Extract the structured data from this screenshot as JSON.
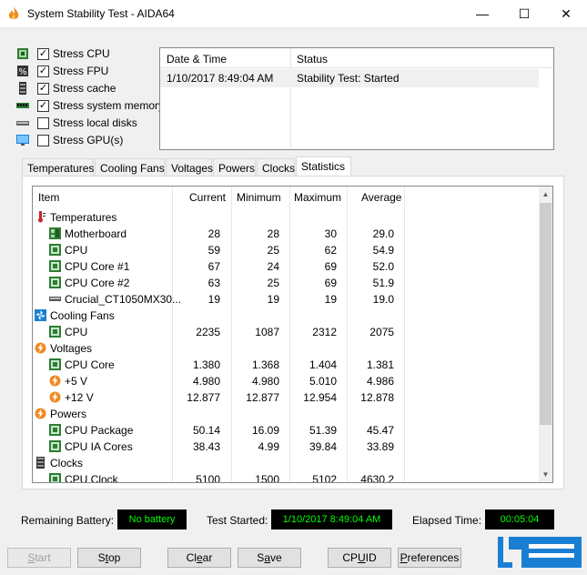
{
  "window": {
    "title": "System Stability Test - AIDA64",
    "minimize": "—",
    "maximize": "☐",
    "close": "✕"
  },
  "stress_options": [
    {
      "label": "Stress CPU",
      "checked": true,
      "icon": "cpu-icon"
    },
    {
      "label": "Stress FPU",
      "checked": true,
      "icon": "fpu-icon"
    },
    {
      "label": "Stress cache",
      "checked": true,
      "icon": "cache-icon"
    },
    {
      "label": "Stress system memory",
      "checked": true,
      "icon": "memory-icon"
    },
    {
      "label": "Stress local disks",
      "checked": false,
      "icon": "disk-icon"
    },
    {
      "label": "Stress GPU(s)",
      "checked": false,
      "icon": "gpu-icon"
    }
  ],
  "log": {
    "headers": [
      "Date & Time",
      "Status"
    ],
    "rows": [
      {
        "datetime": "1/10/2017 8:49:04 AM",
        "status": "Stability Test: Started"
      }
    ]
  },
  "tabs": [
    "Temperatures",
    "Cooling Fans",
    "Voltages",
    "Powers",
    "Clocks",
    "Statistics"
  ],
  "active_tab": "Statistics",
  "stats": {
    "headers": {
      "item": "Item",
      "current": "Current",
      "minimum": "Minimum",
      "maximum": "Maximum",
      "average": "Average"
    },
    "rows": [
      {
        "type": "group",
        "name": "Temperatures",
        "icon": "thermometer-icon"
      },
      {
        "type": "item",
        "name": "Motherboard",
        "icon": "motherboard-icon",
        "current": "28",
        "minimum": "28",
        "maximum": "30",
        "average": "29.0"
      },
      {
        "type": "item",
        "name": "CPU",
        "icon": "cpu-chip-icon",
        "current": "59",
        "minimum": "25",
        "maximum": "62",
        "average": "54.9"
      },
      {
        "type": "item",
        "name": "CPU Core #1",
        "icon": "cpu-chip-icon",
        "current": "67",
        "minimum": "24",
        "maximum": "69",
        "average": "52.0"
      },
      {
        "type": "item",
        "name": "CPU Core #2",
        "icon": "cpu-chip-icon",
        "current": "63",
        "minimum": "25",
        "maximum": "69",
        "average": "51.9"
      },
      {
        "type": "item",
        "name": "Crucial_CT1050MX30...",
        "icon": "drive-icon",
        "current": "19",
        "minimum": "19",
        "maximum": "19",
        "average": "19.0"
      },
      {
        "type": "group",
        "name": "Cooling Fans",
        "icon": "fan-icon"
      },
      {
        "type": "item",
        "name": "CPU",
        "icon": "cpu-chip-icon",
        "current": "2235",
        "minimum": "1087",
        "maximum": "2312",
        "average": "2075"
      },
      {
        "type": "group",
        "name": "Voltages",
        "icon": "voltage-icon"
      },
      {
        "type": "item",
        "name": "CPU Core",
        "icon": "cpu-chip-icon",
        "current": "1.380",
        "minimum": "1.368",
        "maximum": "1.404",
        "average": "1.381"
      },
      {
        "type": "item",
        "name": "+5 V",
        "icon": "voltage-icon",
        "current": "4.980",
        "minimum": "4.980",
        "maximum": "5.010",
        "average": "4.986"
      },
      {
        "type": "item",
        "name": "+12 V",
        "icon": "voltage-icon",
        "current": "12.877",
        "minimum": "12.877",
        "maximum": "12.954",
        "average": "12.878"
      },
      {
        "type": "group",
        "name": "Powers",
        "icon": "power-icon"
      },
      {
        "type": "item",
        "name": "CPU Package",
        "icon": "cpu-chip-icon",
        "current": "50.14",
        "minimum": "16.09",
        "maximum": "51.39",
        "average": "45.47"
      },
      {
        "type": "item",
        "name": "CPU IA Cores",
        "icon": "cpu-chip-icon",
        "current": "38.43",
        "minimum": "4.99",
        "maximum": "39.84",
        "average": "33.89"
      },
      {
        "type": "group",
        "name": "Clocks",
        "icon": "clock-icon"
      },
      {
        "type": "item",
        "name": "CPU Clock",
        "icon": "cpu-chip-icon",
        "current": "5100",
        "minimum": "1500",
        "maximum": "5102",
        "average": "4630.2"
      }
    ]
  },
  "status": {
    "battery_label": "Remaining Battery:",
    "battery_value": "No battery",
    "started_label": "Test Started:",
    "started_value": "1/10/2017 8:49:04 AM",
    "elapsed_label": "Elapsed Time:",
    "elapsed_value": "00:05:04"
  },
  "buttons": {
    "start": {
      "label": "Start",
      "mnemonic_index": 0,
      "enabled": false
    },
    "stop": {
      "label": "Stop",
      "mnemonic_index": 1,
      "enabled": true
    },
    "clear": {
      "label": "Clear",
      "mnemonic_index": 2,
      "enabled": true
    },
    "save": {
      "label": "Save",
      "mnemonic_index": 1,
      "enabled": true
    },
    "cpuid": {
      "label": "CPUID",
      "mnemonic_index": 2,
      "enabled": true
    },
    "preferences": {
      "label": "Preferences",
      "mnemonic_index": 0,
      "enabled": true
    }
  },
  "colors": {
    "status_text": "#00ff00",
    "status_bg": "#000000",
    "logo_blue": "#1a7fd4",
    "flame": "#f08a24"
  }
}
